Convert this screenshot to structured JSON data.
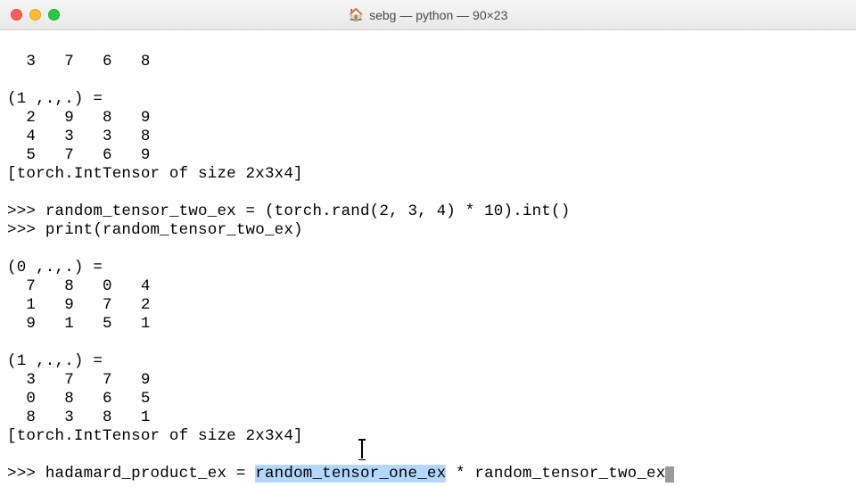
{
  "titlebar": {
    "home_icon": "🏠",
    "title": "sebg — python — 90×23"
  },
  "terminal": {
    "line0": "  3   7   6   8",
    "blank": "",
    "slice1_header": "(1 ,.,.) = ",
    "slice1_row0": "  2   9   8   9",
    "slice1_row1": "  4   3   3   8",
    "slice1_row2": "  5   7   6   9",
    "tensor_info": "[torch.IntTensor of size 2x3x4]",
    "prompt": ">>> ",
    "assign_line": "random_tensor_two_ex = (torch.rand(2, 3, 4) * 10).int()",
    "print_line": "print(random_tensor_two_ex)",
    "slice0b_header": "(0 ,.,.) = ",
    "slice0b_row0": "  7   8   0   4",
    "slice0b_row1": "  1   9   7   2",
    "slice0b_row2": "  9   1   5   1",
    "slice1b_header": "(1 ,.,.) = ",
    "slice1b_row0": "  3   7   7   9",
    "slice1b_row1": "  0   8   6   5",
    "slice1b_row2": "  8   3   8   1",
    "tensor_info2": "[torch.IntTensor of size 2x3x4]",
    "hadamard_pre": "hadamard_product_ex = ",
    "hadamard_sel": "random_tensor_one_ex",
    "hadamard_post": " * random_tensor_two_ex"
  }
}
